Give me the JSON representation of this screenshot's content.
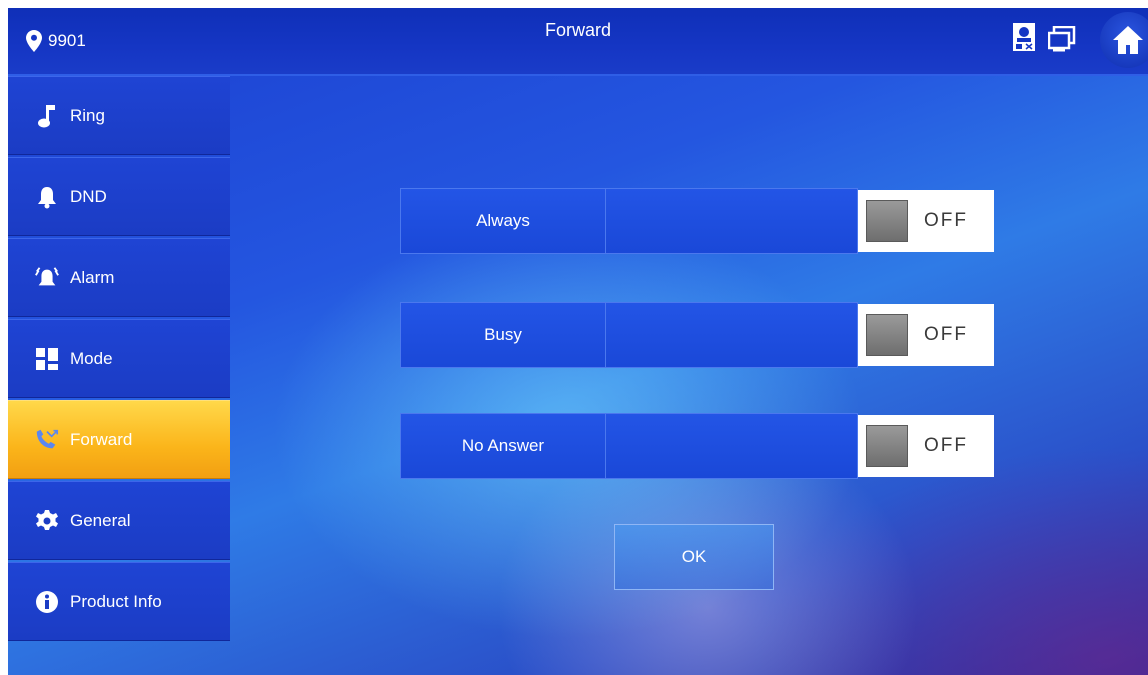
{
  "header": {
    "location_label": "9901",
    "title": "Forward"
  },
  "sidebar": {
    "items": [
      {
        "label": "Ring",
        "icon": "music-note-icon"
      },
      {
        "label": "DND",
        "icon": "bell-icon"
      },
      {
        "label": "Alarm",
        "icon": "alarm-icon"
      },
      {
        "label": "Mode",
        "icon": "mode-grid-icon"
      },
      {
        "label": "Forward",
        "icon": "call-forward-icon",
        "active": true
      },
      {
        "label": "General",
        "icon": "gear-icon"
      },
      {
        "label": "Product Info",
        "icon": "info-icon"
      }
    ]
  },
  "forward": {
    "rows": [
      {
        "label": "Always",
        "toggle": "OFF"
      },
      {
        "label": "Busy",
        "toggle": "OFF"
      },
      {
        "label": "No Answer",
        "toggle": "OFF"
      }
    ],
    "ok_label": "OK"
  },
  "colors": {
    "accent_active": "#fbb51a",
    "background": "#2456e0"
  }
}
